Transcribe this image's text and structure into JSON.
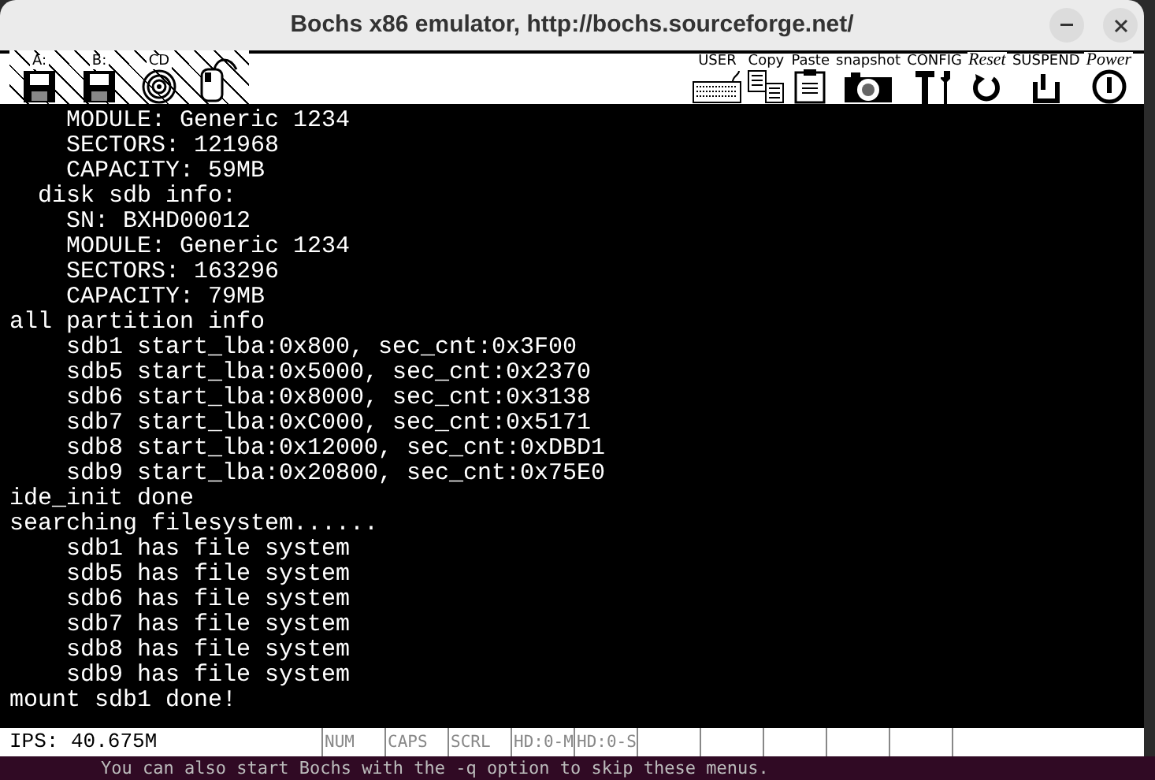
{
  "window": {
    "title": "Bochs x86 emulator, http://bochs.sourceforge.net/"
  },
  "toolbar": {
    "left": [
      {
        "kind": "floppy",
        "label": "A:"
      },
      {
        "kind": "floppy",
        "label": "B:"
      },
      {
        "kind": "cdrom",
        "label": "CD"
      },
      {
        "kind": "mouse"
      }
    ],
    "right": [
      {
        "kind": "user",
        "label": "USER"
      },
      {
        "kind": "copy",
        "label": "Copy"
      },
      {
        "kind": "paste",
        "label": "Paste"
      },
      {
        "kind": "snapshot",
        "label": "snapshot"
      },
      {
        "kind": "config",
        "label": "CONFIG"
      },
      {
        "kind": "reset",
        "label": "Reset"
      },
      {
        "kind": "suspend",
        "label": "SUSPEND"
      },
      {
        "kind": "power",
        "label": "Power"
      }
    ]
  },
  "console": {
    "lines": [
      "    MODULE: Generic 1234",
      "    SECTORS: 121968",
      "    CAPACITY: 59MB",
      "  disk sdb info:",
      "    SN: BXHD00012",
      "    MODULE: Generic 1234",
      "    SECTORS: 163296",
      "    CAPACITY: 79MB",
      "all partition info",
      "    sdb1 start_lba:0x800, sec_cnt:0x3F00",
      "    sdb5 start_lba:0x5000, sec_cnt:0x2370",
      "    sdb6 start_lba:0x8000, sec_cnt:0x3138",
      "    sdb7 start_lba:0xC000, sec_cnt:0x5171",
      "    sdb8 start_lba:0x12000, sec_cnt:0xDBD1",
      "    sdb9 start_lba:0x20800, sec_cnt:0x75E0",
      "ide_init done",
      "searching filesystem......",
      "    sdb1 has file system",
      "    sdb5 has file system",
      "    sdb6 has file system",
      "    sdb7 has file system",
      "    sdb8 has file system",
      "    sdb9 has file system",
      "mount sdb1 done!"
    ]
  },
  "status_bar": {
    "ips": "IPS: 40.675M",
    "indicators": [
      "NUM",
      "CAPS",
      "SCRL",
      "HD:0-M",
      "HD:0-S"
    ]
  },
  "background_terminal": {
    "line": "You can also start Bochs with the -q option to skip these menus."
  }
}
